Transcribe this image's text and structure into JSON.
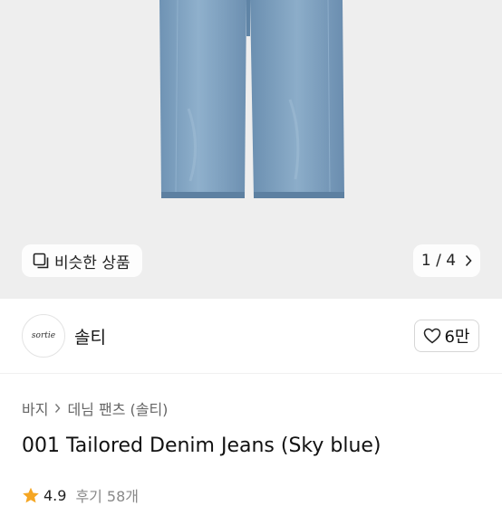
{
  "hero": {
    "similar_label": "비슷한 상품",
    "counter": "1 / 4"
  },
  "store": {
    "logo_text": "sortie",
    "name": "솔티",
    "likes": "6만"
  },
  "breadcrumb": {
    "items": [
      "바지",
      "데님 팬츠 (솔티)"
    ]
  },
  "product": {
    "title": "001 Tailored Denim Jeans (Sky blue)"
  },
  "rating": {
    "value": "4.9",
    "review_label": "후기",
    "review_count": "58개"
  },
  "colors": {
    "hero_bg": "#eeeeee",
    "denim": "#7b9fbe",
    "star": "#f5a623"
  },
  "icons": [
    "similar-items-icon",
    "chevron-right-icon",
    "heart-icon",
    "star-icon"
  ]
}
